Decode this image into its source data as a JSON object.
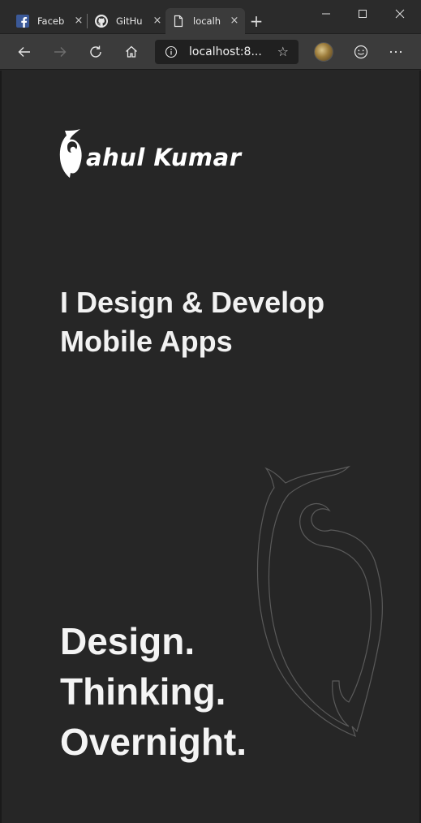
{
  "browser": {
    "tabs": [
      {
        "title": "Faceb",
        "icon": "facebook-icon",
        "active": false
      },
      {
        "title": "GitHu",
        "icon": "github-icon",
        "active": false
      },
      {
        "title": "localh",
        "icon": "page-icon",
        "active": true
      }
    ],
    "tab_close_glyph": "×",
    "new_tab_glyph": "+",
    "address": {
      "url": "localhost:8..."
    },
    "colors": {
      "tabbar": "#2b2b2b",
      "toolbar": "#3b3b3b",
      "address_bg": "#202020"
    }
  },
  "page": {
    "logo_text": "ahul Kumar",
    "tagline": [
      "I Design & Develop",
      "Mobile Apps"
    ],
    "motto": [
      "Design.",
      "Thinking.",
      "Overnight."
    ],
    "colors": {
      "background": "#262626",
      "text": "#ffffff",
      "owl_outline": "#5a5a5a"
    }
  }
}
